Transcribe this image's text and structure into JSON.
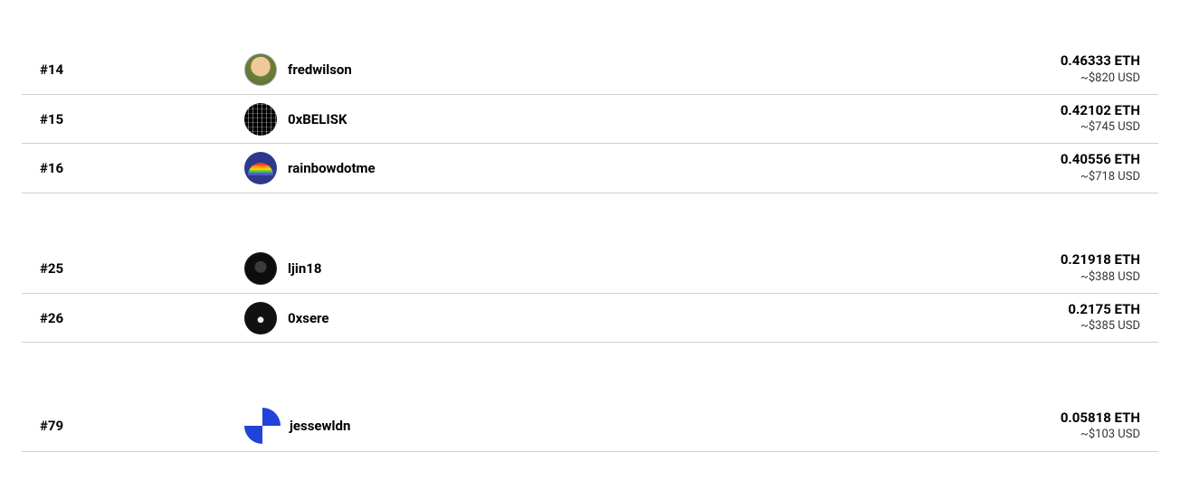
{
  "groups": [
    {
      "rows": [
        {
          "rank": "#14",
          "username": "fredwilson",
          "avatar_class": "av-fredwilson",
          "eth": "0.46333 ETH",
          "usd": "~$820 USD"
        },
        {
          "rank": "#15",
          "username": "0xBELISK",
          "avatar_class": "av-0xbelisk",
          "eth": "0.42102 ETH",
          "usd": "~$745 USD"
        },
        {
          "rank": "#16",
          "username": "rainbowdotme",
          "avatar_class": "av-rainbow",
          "eth": "0.40556 ETH",
          "usd": "~$718 USD"
        }
      ],
      "gap_class": "gap"
    },
    {
      "rows": [
        {
          "rank": "#25",
          "username": "ljin18",
          "avatar_class": "av-ljin18",
          "eth": "0.21918 ETH",
          "usd": "~$388 USD"
        },
        {
          "rank": "#26",
          "username": "0xsere",
          "avatar_class": "av-0xsere",
          "eth": "0.2175 ETH",
          "usd": "~$385 USD"
        }
      ],
      "gap_class": "gap-lg"
    },
    {
      "rows": [
        {
          "rank": "#79",
          "username": "jessewldn",
          "avatar_class": "av-jessewldn",
          "avatar_special": "jessewldn",
          "eth": "0.05818 ETH",
          "usd": "~$103 USD"
        }
      ]
    }
  ]
}
